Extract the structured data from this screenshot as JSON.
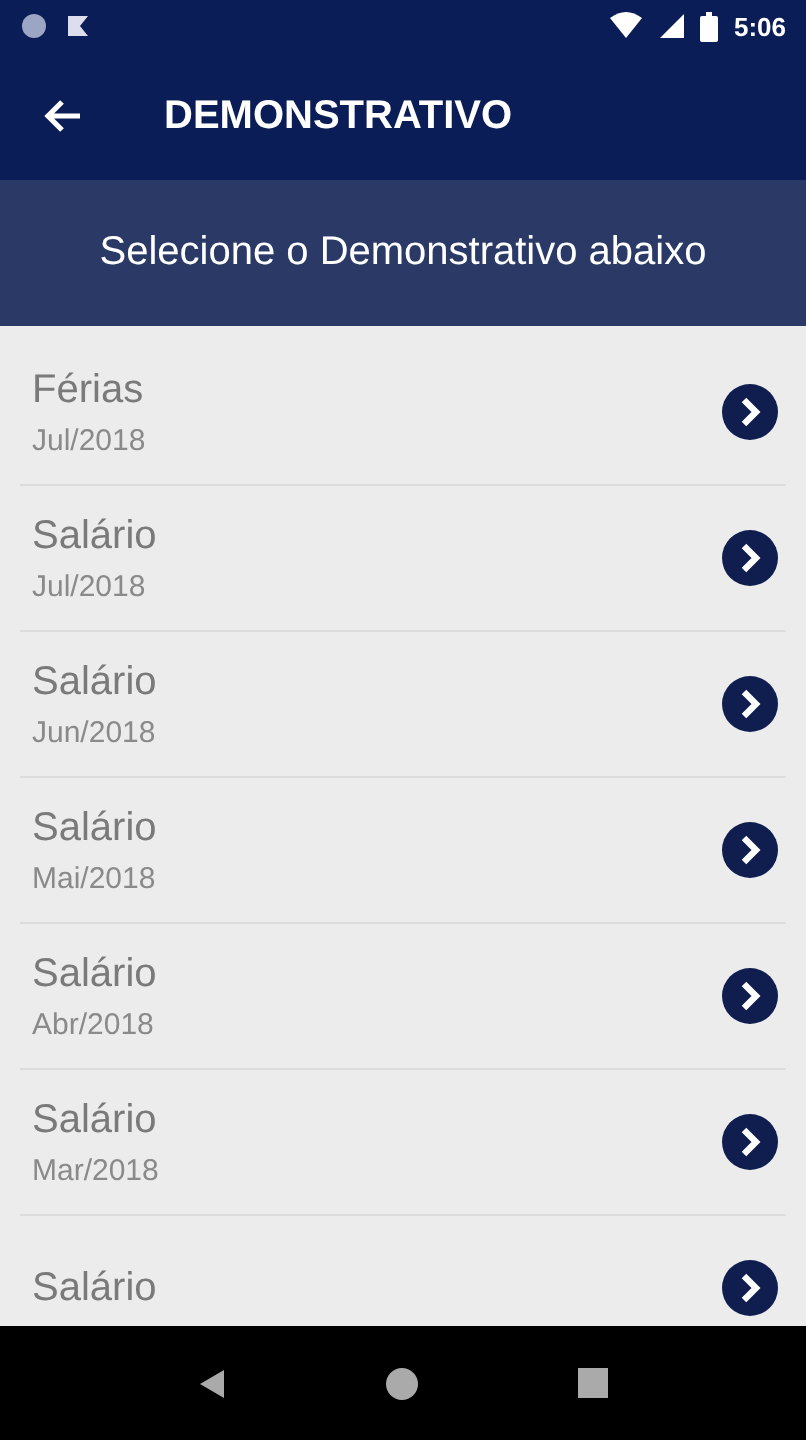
{
  "status_bar": {
    "time": "5:06"
  },
  "app_bar": {
    "title": "DEMONSTRATIVO"
  },
  "subheader": {
    "text": "Selecione o Demonstrativo abaixo"
  },
  "items": [
    {
      "title": "Férias",
      "date": "Jul/2018"
    },
    {
      "title": "Salário",
      "date": "Jul/2018"
    },
    {
      "title": "Salário",
      "date": "Jun/2018"
    },
    {
      "title": "Salário",
      "date": "Mai/2018"
    },
    {
      "title": "Salário",
      "date": "Abr/2018"
    },
    {
      "title": "Salário",
      "date": "Mar/2018"
    },
    {
      "title": "Salário"
    }
  ]
}
